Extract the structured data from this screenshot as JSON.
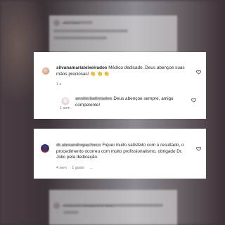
{
  "comments": [
    {
      "username": "silvanamariateixeirados",
      "text": "Médico dedicado. Deus abençoe suas mãos preciosas! 👏 👏 👏",
      "time": "1 s"
    },
    {
      "username": "anobicbatistados",
      "text": "Deus abençoe sempre, amigo competente!",
      "time": "1 sem"
    },
    {
      "username": "dr.alexandrepacheco",
      "text": "Fiquei muito satisfeito com o resultado, o procedimento ocorreu com muito profissionalismo, obrigado Dr. Júlio pela dedicação.",
      "time": "4 sem",
      "likes": "1 gosto",
      "reply": "..."
    }
  ],
  "background_hint": {
    "top_card_title": "Marco Gomes",
    "bottom_card_text": "Formado a ser a dedicação ao Dr. Jonas..."
  },
  "colors": {
    "card_bg": "#ffffff",
    "text": "#262626",
    "meta": "#737373",
    "backdrop": "#3a3238"
  },
  "icons": [
    "heart-icon"
  ]
}
